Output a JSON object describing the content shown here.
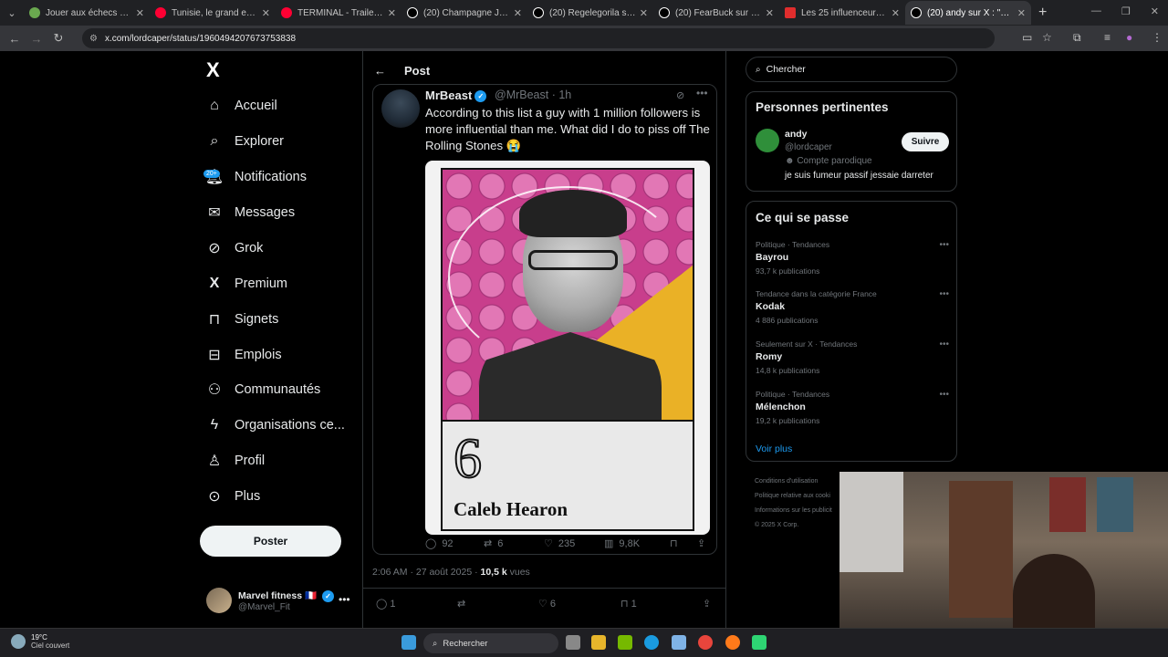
{
  "browser": {
    "tabs": [
      {
        "title": "Jouer aux échecs en ligne",
        "color": "#6aa84f"
      },
      {
        "title": "Tunisie, le grand exode d",
        "color": "#ff0033"
      },
      {
        "title": "TERMINAL - Trailer Offici",
        "color": "#ff0033"
      },
      {
        "title": "(20) Champagne Joshi sur",
        "color": "#ffffff"
      },
      {
        "title": "(20) Regelegorila sur X : \"",
        "color": "#ffffff"
      },
      {
        "title": "(20) FearBuck sur X : \"Top",
        "color": "#ffffff"
      },
      {
        "title": "Les 25 influenceurs et cré",
        "color": "#e02d2d"
      },
      {
        "title": "(20) andy sur X : \"@regel",
        "color": "#ffffff"
      }
    ],
    "url": "x.com/lordcaper/status/1960494207673753838"
  },
  "sidebar": {
    "logo": "X",
    "items": [
      {
        "label": "Accueil",
        "icon": "home-icon"
      },
      {
        "label": "Explorer",
        "icon": "search-icon"
      },
      {
        "label": "Notifications",
        "icon": "bell-icon",
        "badge": "20+"
      },
      {
        "label": "Messages",
        "icon": "mail-icon"
      },
      {
        "label": "Grok",
        "icon": "grok-icon"
      },
      {
        "label": "Premium",
        "icon": "x-premium-icon"
      },
      {
        "label": "Signets",
        "icon": "bookmark-icon"
      },
      {
        "label": "Emplois",
        "icon": "briefcase-icon"
      },
      {
        "label": "Communautés",
        "icon": "communities-icon"
      },
      {
        "label": "Organisations ce...",
        "icon": "lightning-icon"
      },
      {
        "label": "Profil",
        "icon": "person-icon"
      },
      {
        "label": "Plus",
        "icon": "more-circle-icon"
      }
    ],
    "post_button": "Poster",
    "account": {
      "name": "Marvel fitness 🇫🇷",
      "handle": "@Marvel_Fit"
    }
  },
  "main": {
    "header_title": "Post",
    "tweet": {
      "name": "MrBeast",
      "handle": "@MrBeast · 1h",
      "text": "According to this list a guy with 1 million followers is more influential than me. What did I do to piss off The Rolling Stones 😭",
      "image": {
        "rank": "6",
        "person": "Caleb Hearon"
      },
      "counts": {
        "replies": "92",
        "reposts": "6",
        "likes": "235",
        "views": "9,8K"
      }
    },
    "meta": {
      "time": "2:06 AM · 27 août 2025 · ",
      "views": "10,5 k",
      "views_label": " vues"
    },
    "bottom": {
      "replies": "1",
      "likes": "6",
      "bookmarks": "1"
    }
  },
  "right": {
    "search_placeholder": "Chercher",
    "relevant": {
      "title": "Personnes pertinentes",
      "name": "andy",
      "handle": "@lordcaper",
      "tag": "Compte parodique",
      "bio": "je suis fumeur passif jessaie darreter",
      "follow": "Suivre"
    },
    "trending": {
      "title": "Ce qui se passe",
      "items": [
        {
          "ctx": "Politique · Tendances",
          "name": "Bayrou",
          "count": "93,7 k publications"
        },
        {
          "ctx": "Tendance dans la catégorie France",
          "name": "Kodak",
          "count": "4 886 publications"
        },
        {
          "ctx": "Seulement sur X · Tendances",
          "name": "Romy",
          "count": "14,8 k publications"
        },
        {
          "ctx": "Politique · Tendances",
          "name": "Mélenchon",
          "count": "19,2 k publications"
        }
      ],
      "more": "Voir plus"
    },
    "footer": [
      "Conditions d'utilisation",
      "Politique relative aux cooki",
      "Informations sur les publicit",
      "© 2025 X Corp."
    ]
  },
  "taskbar": {
    "weather_temp": "19°C",
    "weather_desc": "Ciel couvert",
    "search": "Rechercher"
  }
}
